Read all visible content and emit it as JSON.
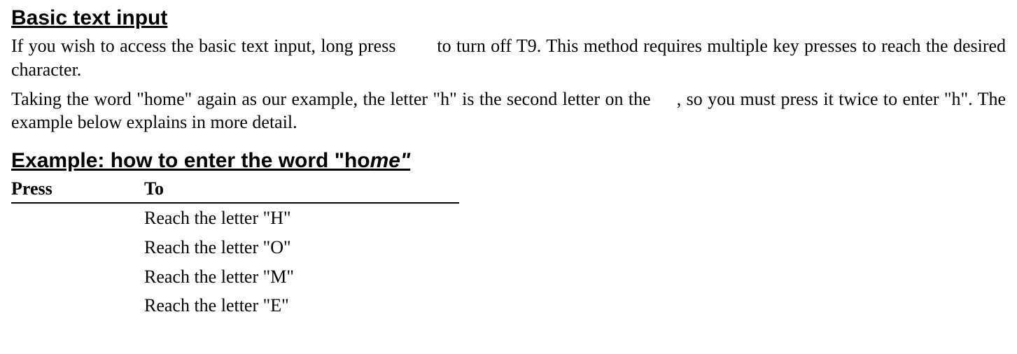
{
  "heading": "Basic text input",
  "paragraphs": {
    "p1_a": "If you wish to access the basic text input, long press ",
    "p1_b": " to turn off T9. This method requires multiple key presses to reach the desired character.",
    "p2_a": "Taking the word \"home\" again as our example, the letter \"h\" is the second letter on the ",
    "p2_b": ", so you must press it twice to enter \"h\". The example below explains in more detail."
  },
  "example_heading": {
    "prefix": "Example: how to enter the word \"ho",
    "italic": "me\""
  },
  "table": {
    "headers": {
      "press": "Press",
      "to": "To"
    },
    "rows": [
      {
        "press": "",
        "to": "Reach the letter \"H\""
      },
      {
        "press": "",
        "to": "Reach the letter \"O\""
      },
      {
        "press": "",
        "to": "Reach the letter \"M\""
      },
      {
        "press": "",
        "to": "Reach the letter \"E\""
      }
    ]
  }
}
